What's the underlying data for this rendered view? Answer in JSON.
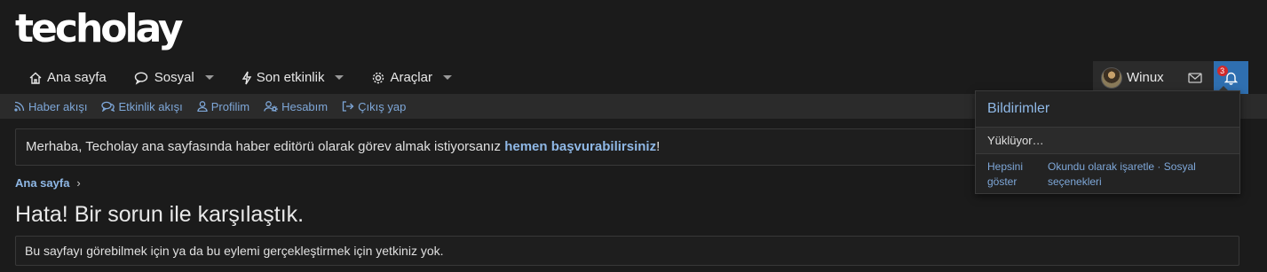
{
  "logo": "techolay",
  "nav": {
    "items": [
      {
        "label": "Ana sayfa",
        "icon": "home-icon",
        "has_dropdown": false
      },
      {
        "label": "Sosyal",
        "icon": "chat-icon",
        "has_dropdown": true
      },
      {
        "label": "Son etkinlik",
        "icon": "bolt-icon",
        "has_dropdown": true
      },
      {
        "label": "Araçlar",
        "icon": "gear-icon",
        "has_dropdown": true
      }
    ]
  },
  "user": {
    "name": "Winux",
    "notification_count": "3"
  },
  "subnav": {
    "items": [
      {
        "label": "Haber akışı",
        "icon": "rss-icon"
      },
      {
        "label": "Etkinlik akışı",
        "icon": "comments-icon"
      },
      {
        "label": "Profilim",
        "icon": "user-icon"
      },
      {
        "label": "Hesabım",
        "icon": "user-cog-icon"
      },
      {
        "label": "Çıkış yap",
        "icon": "sign-out-icon"
      }
    ]
  },
  "notice": {
    "text": "Merhaba, Techolay ana sayfasında haber editörü olarak görev almak istiyorsanız ",
    "link": "hemen başvurabilirsiniz",
    "suffix": "!"
  },
  "breadcrumb": {
    "label": "Ana sayfa"
  },
  "page_title": "Hata! Bir sorun ile karşılaştık.",
  "error_message": "Bu sayfayı görebilmek için ya da bu eylemi gerçekleştirmek için yetkiniz yok.",
  "notifications_menu": {
    "title": "Bildirimler",
    "loading": "Yüklüyor…",
    "show_all": "Hepsini göster",
    "mark_read": "Okundu olarak işaretle",
    "separator": "·",
    "social_options": "Sosyal seçenekleri"
  },
  "colors": {
    "background": "#1b1b1b",
    "accent": "#2f6fb0",
    "link": "#8fb8e6",
    "badge": "#d12a2a"
  }
}
